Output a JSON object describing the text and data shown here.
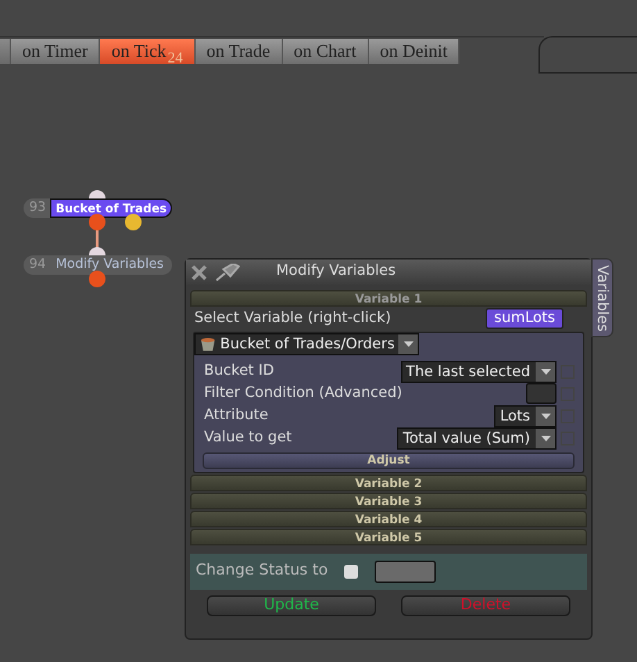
{
  "tabs": [
    {
      "label": "on Timer",
      "selected": false
    },
    {
      "label": "on Tick",
      "badge": "24",
      "selected": true
    },
    {
      "label": "on Trade",
      "selected": false
    },
    {
      "label": "on Chart",
      "selected": false
    },
    {
      "label": "on Deinit",
      "selected": false
    }
  ],
  "nodes": [
    {
      "number": "93",
      "label": "Bucket of Trades",
      "selected": true
    },
    {
      "number": "94",
      "label": "Modify Variables",
      "selected": false
    }
  ],
  "dialog": {
    "title": "Modify Variables",
    "side_tab": "Variables",
    "sections": [
      {
        "title": "Variable 1",
        "expanded": true,
        "select_label": "Select Variable (right-click)",
        "variable": "sumLots",
        "block": "Bucket of Trades/Orders",
        "fields": [
          {
            "label": "Bucket ID",
            "kind": "select",
            "value": "The last selected"
          },
          {
            "label": "Filter Condition (Advanced)",
            "kind": "box"
          },
          {
            "label": "Attribute",
            "kind": "select",
            "value": "Lots"
          },
          {
            "label": "Value to get",
            "kind": "select",
            "value": "Total value (Sum)"
          }
        ],
        "button": "Adjust"
      },
      {
        "title": "Variable 2",
        "expanded": false
      },
      {
        "title": "Variable 3",
        "expanded": false
      },
      {
        "title": "Variable 4",
        "expanded": false
      },
      {
        "title": "Variable 5",
        "expanded": false
      }
    ],
    "status": {
      "label": "Change Status to",
      "checked": false
    },
    "buttons": [
      {
        "label": "Update",
        "kind": "update"
      },
      {
        "label": "Delete",
        "kind": "delete"
      }
    ]
  }
}
